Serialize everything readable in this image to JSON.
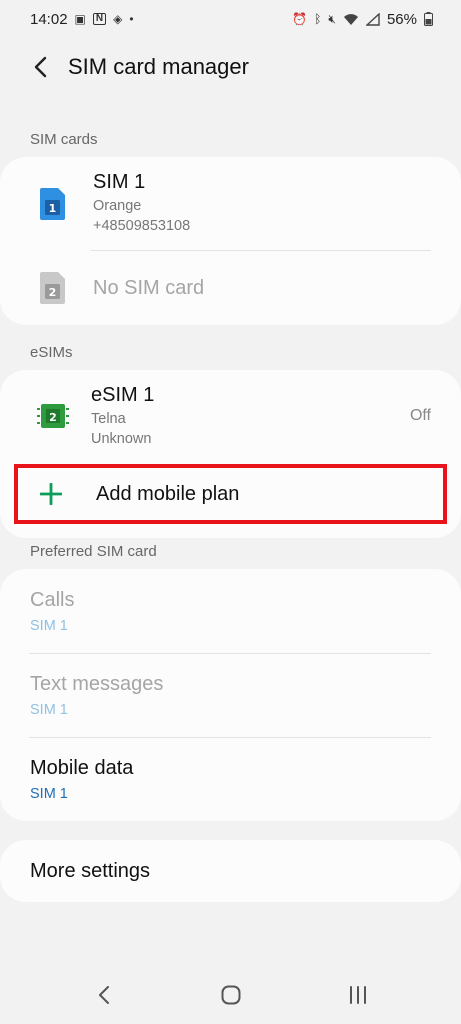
{
  "status": {
    "time": "14:02",
    "battery": "56%"
  },
  "header": {
    "title": "SIM card manager"
  },
  "sections": {
    "sim_cards": "SIM cards",
    "esims": "eSIMs",
    "preferred": "Preferred SIM card"
  },
  "sim_cards": [
    {
      "title": "SIM 1",
      "carrier": "Orange",
      "number": "+48509853108",
      "badge": "1"
    },
    {
      "title": "No SIM card",
      "badge": "2"
    }
  ],
  "esim": {
    "title": "eSIM 1",
    "carrier": "Telna",
    "status": "Unknown",
    "state": "Off",
    "badge": "2"
  },
  "add_plan": {
    "label": "Add mobile plan"
  },
  "preferred": [
    {
      "title": "Calls",
      "value": "SIM 1"
    },
    {
      "title": "Text messages",
      "value": "SIM 1"
    },
    {
      "title": "Mobile data",
      "value": "SIM 1"
    }
  ],
  "more": {
    "label": "More settings"
  },
  "colors": {
    "accent_blue": "#1e6fb4",
    "add_green": "#0d9d58",
    "highlight_red": "#e8131b",
    "esim_green": "#2e9c3e"
  }
}
